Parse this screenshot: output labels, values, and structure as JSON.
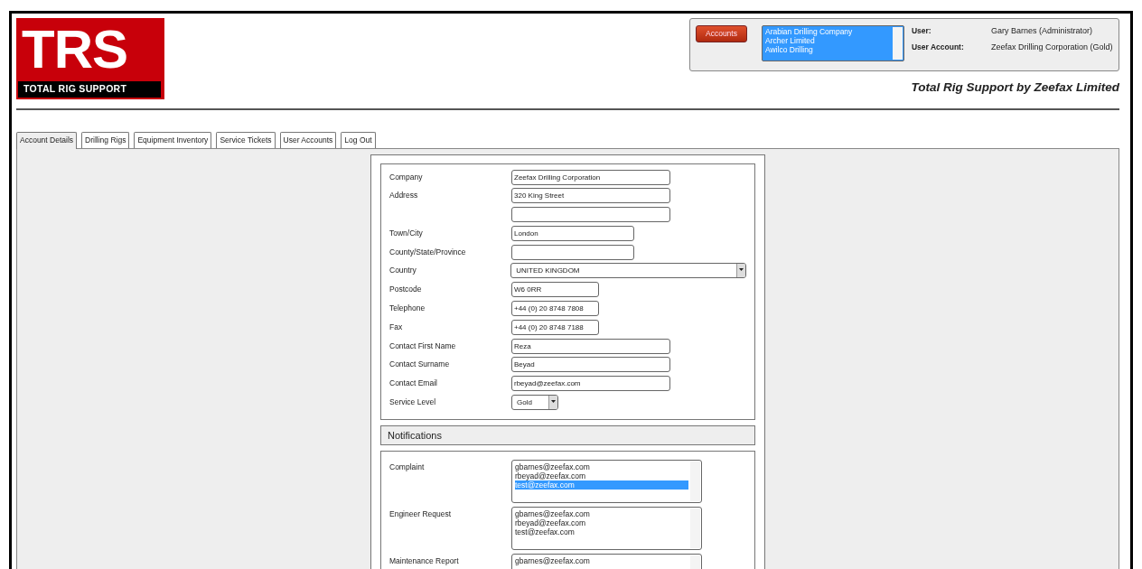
{
  "logo": {
    "letters": "TRS",
    "caption": "TOTAL RIG SUPPORT"
  },
  "account_panel": {
    "button": "Accounts",
    "accounts_list": [
      {
        "label": "Arabian Drilling Company",
        "selected": true
      },
      {
        "label": "Archer Limited",
        "selected": true
      },
      {
        "label": "Awilco Drilling",
        "selected": true
      }
    ],
    "info": [
      {
        "label": "User:",
        "value": "Gary Barnes (Administrator)"
      },
      {
        "label": "User Account:",
        "value": "Zeefax Drilling Corporation (Gold)"
      }
    ]
  },
  "tagline": "Total Rig Support by Zeefax Limited",
  "tabs": [
    {
      "label": "Account Details",
      "selected": true
    },
    {
      "label": "Drilling Rigs",
      "selected": false
    },
    {
      "label": "Equipment Inventory",
      "selected": false
    },
    {
      "label": "Service Tickets",
      "selected": false
    },
    {
      "label": "User Accounts",
      "selected": false
    },
    {
      "label": "Log Out",
      "selected": false
    }
  ],
  "account_form": [
    {
      "kind": "text",
      "label": "Company",
      "value": "Zeefax Drilling Corporation"
    },
    {
      "kind": "text",
      "label": "Address",
      "value": "320 King Street"
    },
    {
      "kind": "text"
    },
    {
      "kind": "text",
      "label": "Town/City",
      "value": "London"
    },
    {
      "kind": "text",
      "label": "County/State/Province"
    },
    {
      "kind": "select",
      "label": "Country",
      "value": "UNITED KINGDOM"
    },
    {
      "kind": "text",
      "label": "Postcode",
      "value": "W6 0RR"
    },
    {
      "kind": "text",
      "label": "Telephone",
      "value": "+44 (0) 20 8748 7808"
    },
    {
      "kind": "text",
      "label": "Fax",
      "value": "+44 (0) 20 8748 7188"
    },
    {
      "kind": "text",
      "label": "Contact First Name",
      "value": "Reza"
    },
    {
      "kind": "text",
      "label": "Contact Surname",
      "value": "Beyad"
    },
    {
      "kind": "text",
      "label": "Contact Email",
      "value": "rbeyad@zeefax.com"
    },
    {
      "kind": "select",
      "label": "Service Level",
      "value": "Gold"
    }
  ],
  "notifications": {
    "title": "Notifications",
    "lists": [
      {
        "label": "Complaint",
        "items": [
          {
            "label": "gbarnes@zeefax.com",
            "selected": false
          },
          {
            "label": "rbeyad@zeefax.com",
            "selected": false
          },
          {
            "label": "test@zeefax.com",
            "selected": true
          }
        ]
      },
      {
        "label": "Engineer Request",
        "items": [
          {
            "label": "gbarnes@zeefax.com",
            "selected": false
          },
          {
            "label": "rbeyad@zeefax.com",
            "selected": false
          },
          {
            "label": "test@zeefax.com",
            "selected": false
          }
        ]
      },
      {
        "label": "Maintenance Report",
        "items": [
          {
            "label": "gbarnes@zeefax.com",
            "selected": false
          }
        ]
      }
    ]
  }
}
